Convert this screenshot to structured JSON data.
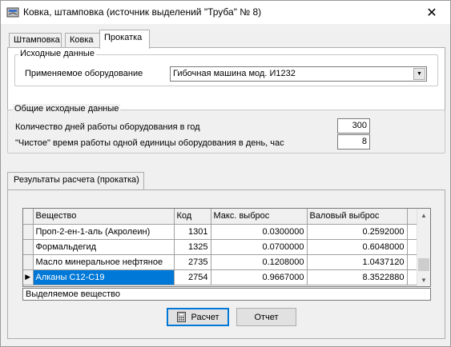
{
  "window": {
    "title": "Ковка, штамповка (источник выделений \"Труба\" № 8)",
    "close_glyph": "✕"
  },
  "tabs": [
    {
      "label": "Штамповка",
      "active": false
    },
    {
      "label": "Ковка",
      "active": false
    },
    {
      "label": "Прокатка",
      "active": true
    }
  ],
  "initial_data": {
    "legend": "Исходные данные",
    "equipment_label": "Применяемое оборудование",
    "equipment_value": "Гибочная машина мод. И1232"
  },
  "general_data": {
    "legend": "Общие исходные данные",
    "days_label": "Количество дней работы оборудования в год",
    "days_value": "300",
    "hours_label": "\"Чистое\" время работы одной единицы оборудования в день, час",
    "hours_value": "8"
  },
  "results": {
    "tab_label": "Результаты расчета (прокатка)",
    "columns": [
      "Вещество",
      "Код",
      "Макс. выброс",
      "Валовый выброс"
    ],
    "rows": [
      {
        "name": "Проп-2-ен-1-аль (Акролеин)",
        "code": "1301",
        "max": "0.0300000",
        "gross": "0.2592000"
      },
      {
        "name": "Формальдегид",
        "code": "1325",
        "max": "0.0700000",
        "gross": "0.6048000"
      },
      {
        "name": "Масло минеральное нефтяное",
        "code": "2735",
        "max": "0.1208000",
        "gross": "1.0437120"
      },
      {
        "name": "Алканы С12-С19",
        "code": "2754",
        "max": "0.9667000",
        "gross": "8.3522880"
      }
    ],
    "selected_row_index": 3,
    "status_text": "Выделяемое вещество"
  },
  "buttons": {
    "calc_label": "Расчет",
    "report_label": "Отчет"
  },
  "colors": {
    "selection": "#0078d7",
    "window_bg": "#f0f0f0"
  }
}
